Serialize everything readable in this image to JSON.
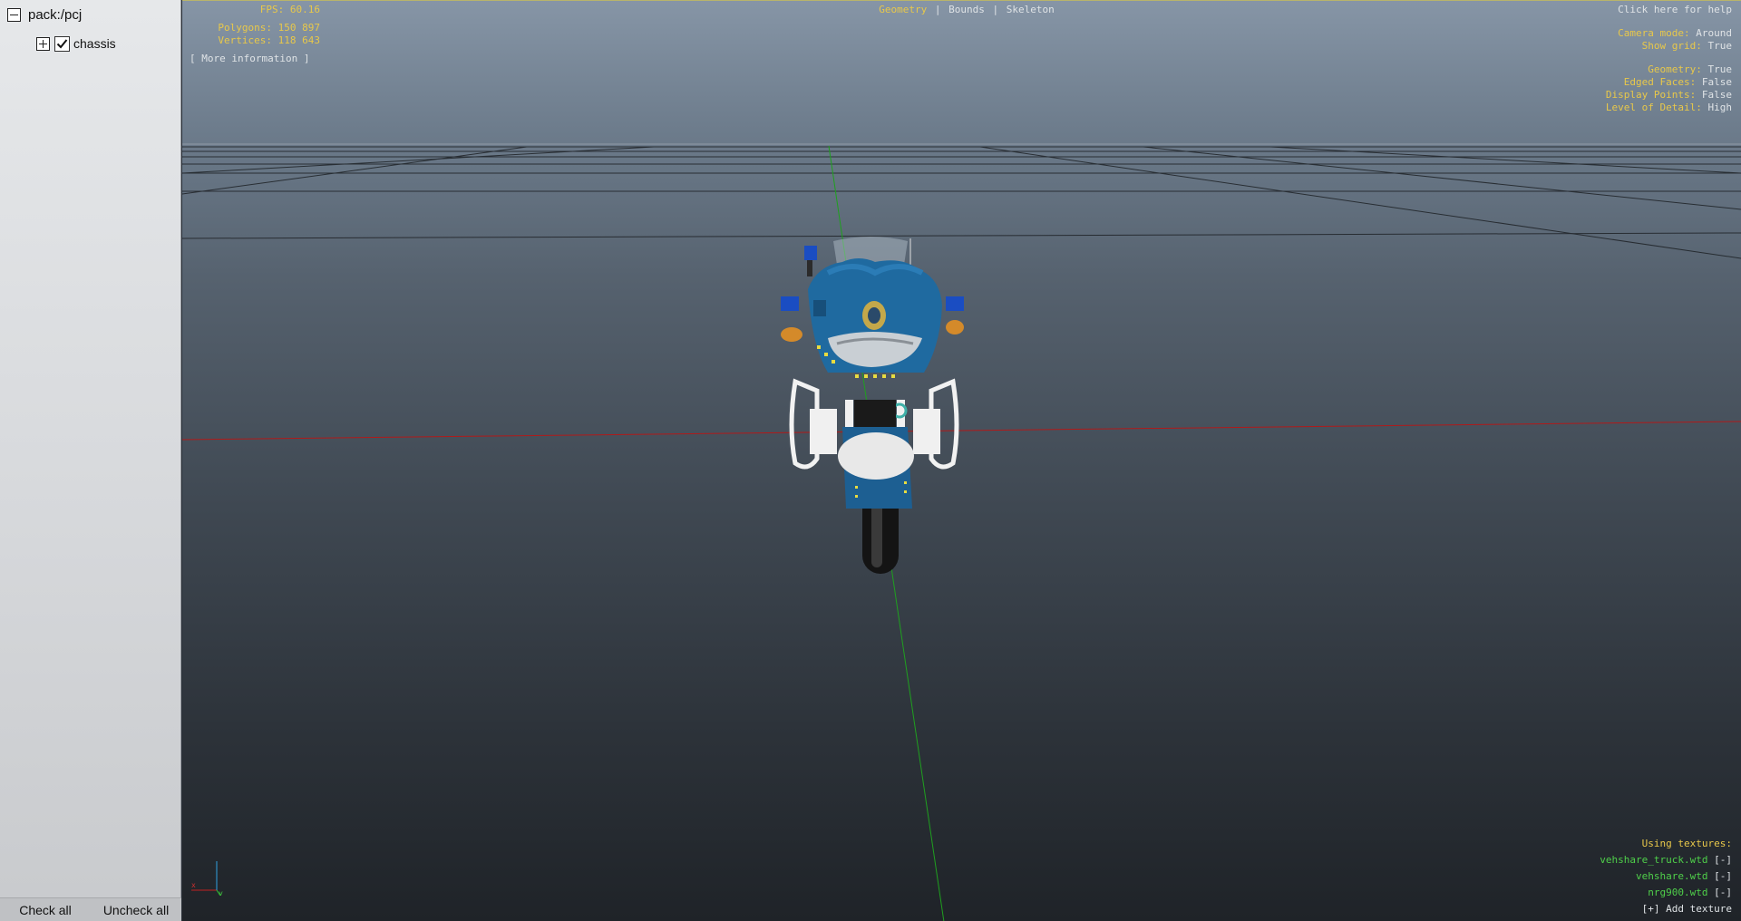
{
  "tree": {
    "root_label": "pack:/pcj",
    "child_label": "chassis",
    "child_checked": true
  },
  "side_buttons": {
    "check_all": "Check all",
    "uncheck_all": "Uncheck all"
  },
  "hud": {
    "fps": "FPS: 60.16",
    "polygons": "Polygons: 150 897",
    "vertices": "Vertices: 118 643",
    "more_info": "[ More information ]",
    "tabs": {
      "geometry": "Geometry",
      "bounds": "Bounds",
      "skeleton": "Skeleton",
      "separator": "|"
    },
    "help": "Click here for help",
    "settings": {
      "camera_mode_label": "Camera mode:",
      "camera_mode_value": "Around",
      "show_grid_label": "Show grid:",
      "show_grid_value": "True",
      "geometry_label": "Geometry:",
      "geometry_value": "True",
      "edged_faces_label": "Edged Faces:",
      "edged_faces_value": "False",
      "display_points_label": "Display Points:",
      "display_points_value": "False",
      "lod_label": "Level of Detail:",
      "lod_value": "High"
    },
    "textures": {
      "header": "Using textures:",
      "items": [
        "vehshare_truck.wtd",
        "vehshare.wtd",
        "nrg900.wtd"
      ],
      "remove": "[-]",
      "add": "[+] Add texture"
    },
    "axis": {
      "x": "x",
      "y": "y"
    }
  },
  "colors": {
    "hud_yellow": "#e8c84a",
    "hud_green": "#4fd04a",
    "bike_blue": "#1f6aa0"
  }
}
